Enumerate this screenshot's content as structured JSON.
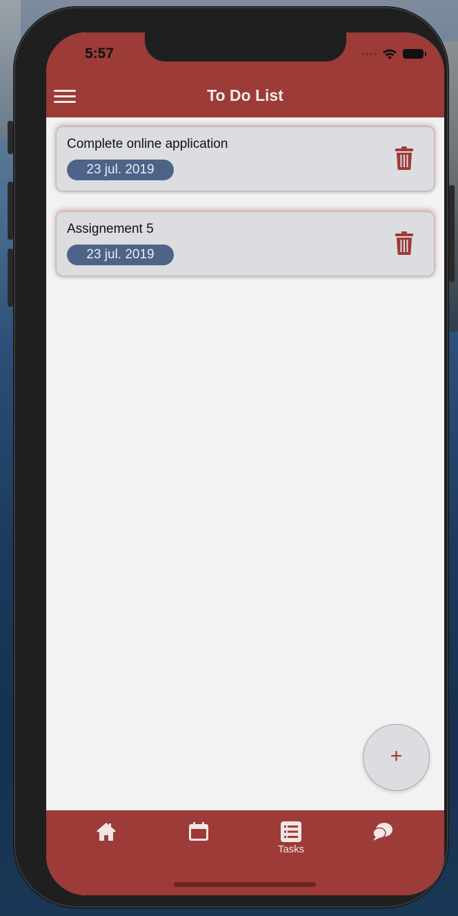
{
  "status_bar": {
    "time": "5:57"
  },
  "header": {
    "title": "To Do List"
  },
  "tasks": [
    {
      "title": "Complete online application",
      "date": "23 jul. 2019"
    },
    {
      "title": "Assignement 5",
      "date": "23 jul. 2019"
    }
  ],
  "fab": {
    "symbol": "+"
  },
  "tabbar": {
    "tabs": [
      {
        "icon": "home-icon",
        "label": ""
      },
      {
        "icon": "calendar-icon",
        "label": ""
      },
      {
        "icon": "list-icon",
        "label": "Tasks"
      },
      {
        "icon": "chat-icon",
        "label": ""
      }
    ]
  },
  "colors": {
    "primary": "#9c3b37",
    "badge": "#4e6388",
    "card": "#dcdde0",
    "background": "#f2f2f2"
  }
}
